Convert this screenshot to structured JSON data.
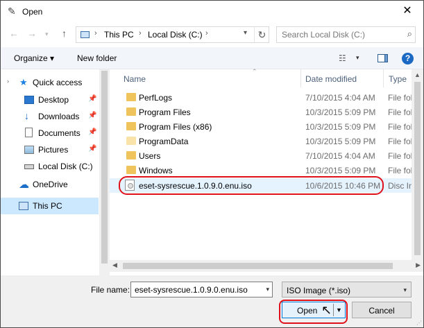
{
  "window": {
    "title": "Open",
    "close_label": "✕"
  },
  "address": {
    "crumbs": [
      "This PC",
      "Local Disk (C:)"
    ],
    "separator": "›"
  },
  "search": {
    "placeholder": "Search Local Disk (C:)"
  },
  "toolbar": {
    "organize_label": "Organize ▾",
    "new_folder_label": "New folder",
    "help_label": "?"
  },
  "sidebar": {
    "items": [
      {
        "label": "Quick access",
        "icon": "star-icon",
        "pinned": false
      },
      {
        "label": "Desktop",
        "icon": "desktop-icon",
        "pinned": true
      },
      {
        "label": "Downloads",
        "icon": "download-icon",
        "pinned": true
      },
      {
        "label": "Documents",
        "icon": "documents-icon",
        "pinned": true
      },
      {
        "label": "Pictures",
        "icon": "pictures-icon",
        "pinned": true
      },
      {
        "label": "Local Disk (C:)",
        "icon": "drive-icon",
        "pinned": false
      },
      {
        "label": "OneDrive",
        "icon": "cloud-icon",
        "pinned": false
      },
      {
        "label": "This PC",
        "icon": "computer-icon",
        "pinned": false
      }
    ]
  },
  "columns": {
    "name": "Name",
    "date": "Date modified",
    "type": "Type"
  },
  "files": [
    {
      "name": "PerfLogs",
      "date": "7/10/2015 4:04 AM",
      "type": "File folder",
      "icon": "folder-icon"
    },
    {
      "name": "Program Files",
      "date": "10/3/2015 5:09 PM",
      "type": "File folder",
      "icon": "folder-icon"
    },
    {
      "name": "Program Files (x86)",
      "date": "10/3/2015 5:09 PM",
      "type": "File folder",
      "icon": "folder-icon"
    },
    {
      "name": "ProgramData",
      "date": "10/3/2015 5:09 PM",
      "type": "File folder",
      "icon": "folder-icon"
    },
    {
      "name": "Users",
      "date": "7/10/2015 4:04 AM",
      "type": "File folder",
      "icon": "folder-icon"
    },
    {
      "name": "Windows",
      "date": "10/3/2015 5:09 PM",
      "type": "File folder",
      "icon": "folder-icon"
    },
    {
      "name": "eset-sysrescue.1.0.9.0.enu.iso",
      "date": "10/6/2015 10:46 PM",
      "type": "Disc Image",
      "icon": "disc-image-icon"
    }
  ],
  "footer": {
    "filename_label": "File name:",
    "filename_value": "eset-sysrescue.1.0.9.0.enu.iso",
    "filetype_value": "ISO Image (*.iso)",
    "open_label": "Open",
    "cancel_label": "Cancel"
  },
  "colors": {
    "accent": "#0078d7",
    "highlight": "#e0101a",
    "selection": "#cce8ff"
  }
}
